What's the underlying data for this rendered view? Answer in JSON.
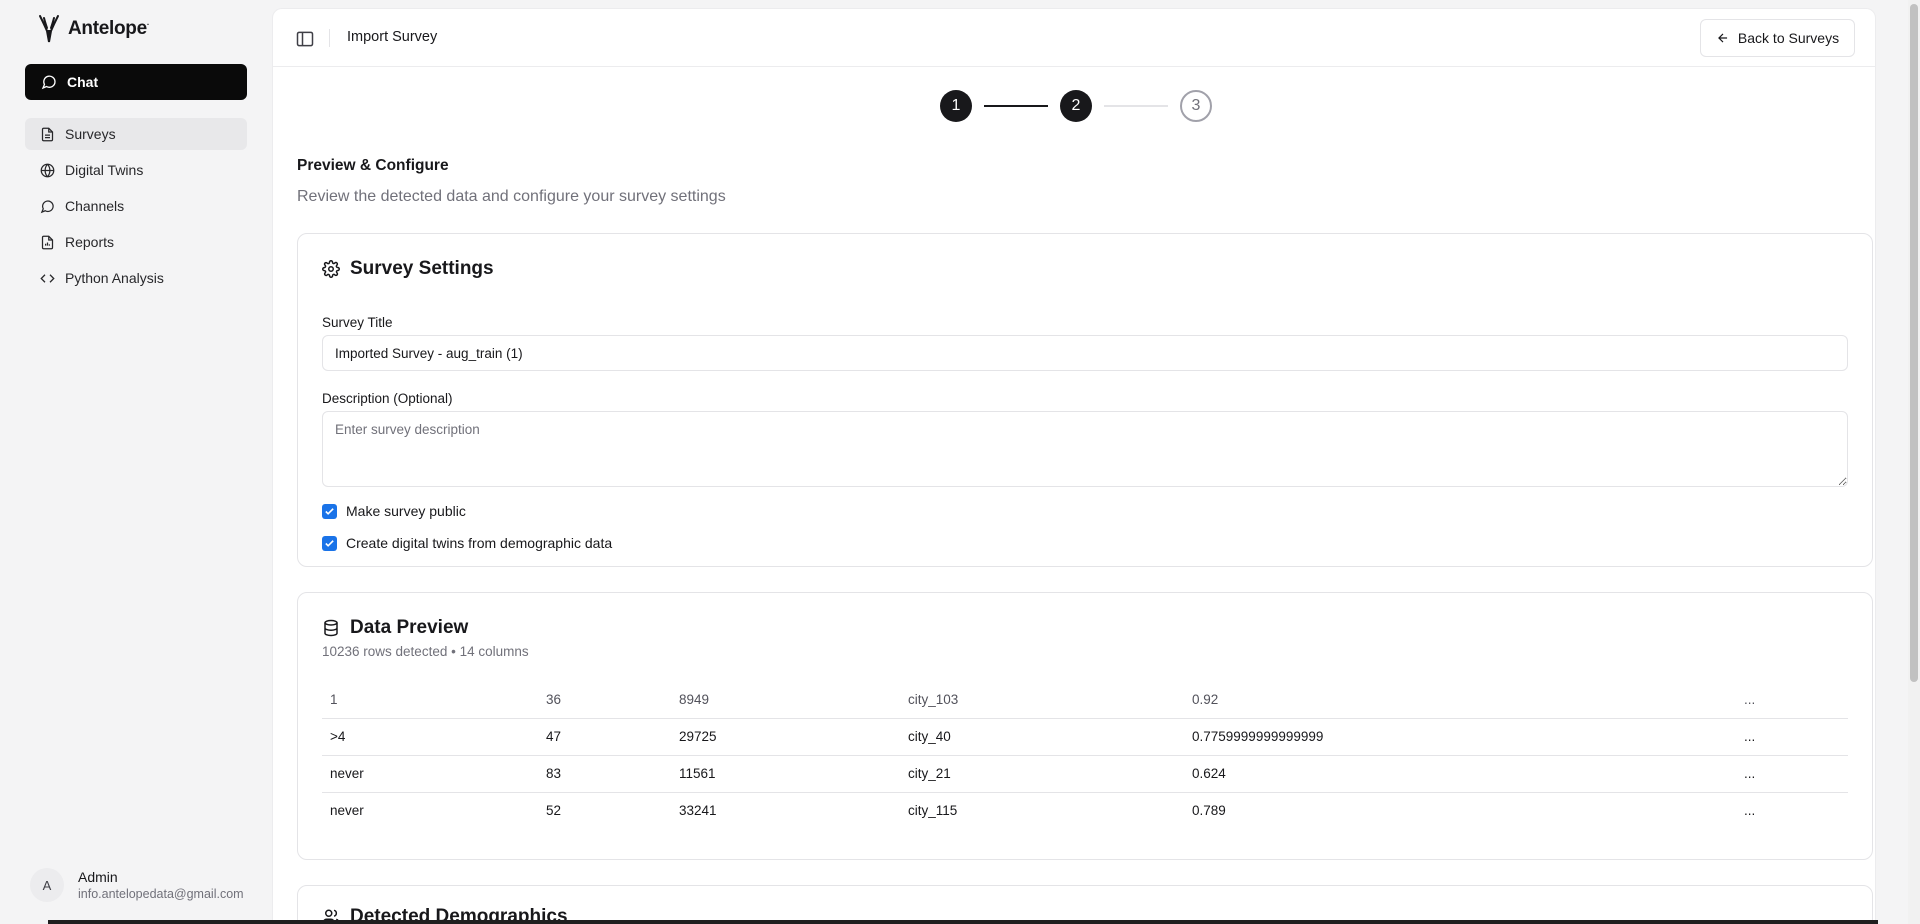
{
  "sidebar": {
    "brand": "Antelope",
    "brand_mark": "·",
    "chat_label": "Chat",
    "items": [
      {
        "label": "Surveys",
        "icon": "file-icon"
      },
      {
        "label": "Digital Twins",
        "icon": "globe-icon"
      },
      {
        "label": "Channels",
        "icon": "message-icon"
      },
      {
        "label": "Reports",
        "icon": "report-icon"
      },
      {
        "label": "Python Analysis",
        "icon": "code-icon"
      }
    ],
    "user": {
      "initial": "A",
      "name": "Admin",
      "email": "info.antelopedata@gmail.com"
    }
  },
  "topbar": {
    "title": "Import Survey",
    "back_label": "Back to Surveys"
  },
  "stepper": {
    "steps": [
      "1",
      "2",
      "3"
    ],
    "current": 2
  },
  "section": {
    "title": "Preview & Configure",
    "subtitle": "Review the detected data and configure your survey settings"
  },
  "settings": {
    "title": "Survey Settings",
    "title_label": "Survey Title",
    "title_value": "Imported Survey - aug_train (1)",
    "description_label": "Description (Optional)",
    "description_placeholder": "Enter survey description",
    "public_label": "Make survey public",
    "public_checked": true,
    "twins_label": "Create digital twins from demographic data",
    "twins_checked": true
  },
  "preview": {
    "title": "Data Preview",
    "summary": "10236 rows detected • 14 columns",
    "rows": [
      [
        "1",
        "36",
        "8949",
        "city_103",
        "0.92",
        "..."
      ],
      [
        ">4",
        "47",
        "29725",
        "city_40",
        "0.7759999999999999",
        "..."
      ],
      [
        "never",
        "83",
        "11561",
        "city_21",
        "0.624",
        "..."
      ],
      [
        "never",
        "52",
        "33241",
        "city_115",
        "0.789",
        "..."
      ]
    ]
  },
  "demographics": {
    "title": "Detected Demographics"
  },
  "colors": {
    "primary": "#18181b",
    "accent": "#1a73e8",
    "muted": "#71717a"
  }
}
